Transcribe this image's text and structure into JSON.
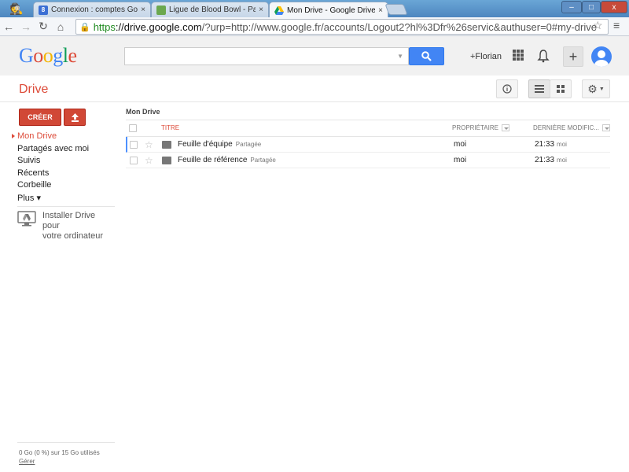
{
  "browser": {
    "tabs": [
      {
        "label": "Connexion : comptes Goo",
        "close": "×"
      },
      {
        "label": "Ligue de Blood Bowl - Pag",
        "close": "×"
      },
      {
        "label": "Mon Drive - Google Drive",
        "close": "×"
      }
    ],
    "url_https": "https",
    "url_host": "://drive.google.com",
    "url_rest": "/?urp=http://www.google.fr/accounts/Logout2?hl%3Dfr%26servic&authuser=0#my-drive",
    "window_buttons": {
      "minimize": "–",
      "maximize": "□",
      "close": "x"
    }
  },
  "header": {
    "logo_letters": [
      "G",
      "o",
      "o",
      "g",
      "l",
      "e"
    ],
    "logo_colors": [
      "#4285f4",
      "#dd4b39",
      "#f4b400",
      "#4285f4",
      "#0f9d58",
      "#dd4b39"
    ],
    "search_placeholder": "",
    "user_link": "+Florian"
  },
  "drive": {
    "title": "Drive"
  },
  "sidebar": {
    "create_label": "CRÉER",
    "nav": [
      {
        "label": "Mon Drive",
        "active": true
      },
      {
        "label": "Partagés avec moi"
      },
      {
        "label": "Suivis"
      },
      {
        "label": "Récents"
      },
      {
        "label": "Corbeille"
      },
      {
        "label": "Plus ▾"
      }
    ],
    "install_line1": "Installer Drive pour",
    "install_line2": "votre ordinateur",
    "quota": "0 Go (0 %) sur 15 Go utilisés",
    "manage": "Gérer"
  },
  "main": {
    "breadcrumb": "Mon Drive",
    "columns": {
      "title": "TITRE",
      "owner": "PROPRIÉTAIRE",
      "modified": "DERNIÈRE MODIFIC..."
    },
    "files": [
      {
        "name": "Feuille d'équipe",
        "tag": "Partagée",
        "owner": "moi",
        "time": "21:33",
        "by": "moi"
      },
      {
        "name": "Feuille de référence",
        "tag": "Partagée",
        "owner": "moi",
        "time": "21:33",
        "by": "moi"
      }
    ]
  },
  "colors": {
    "accent_red": "#dd4b39",
    "button_red": "#d14836",
    "search_blue": "#4285f4"
  }
}
